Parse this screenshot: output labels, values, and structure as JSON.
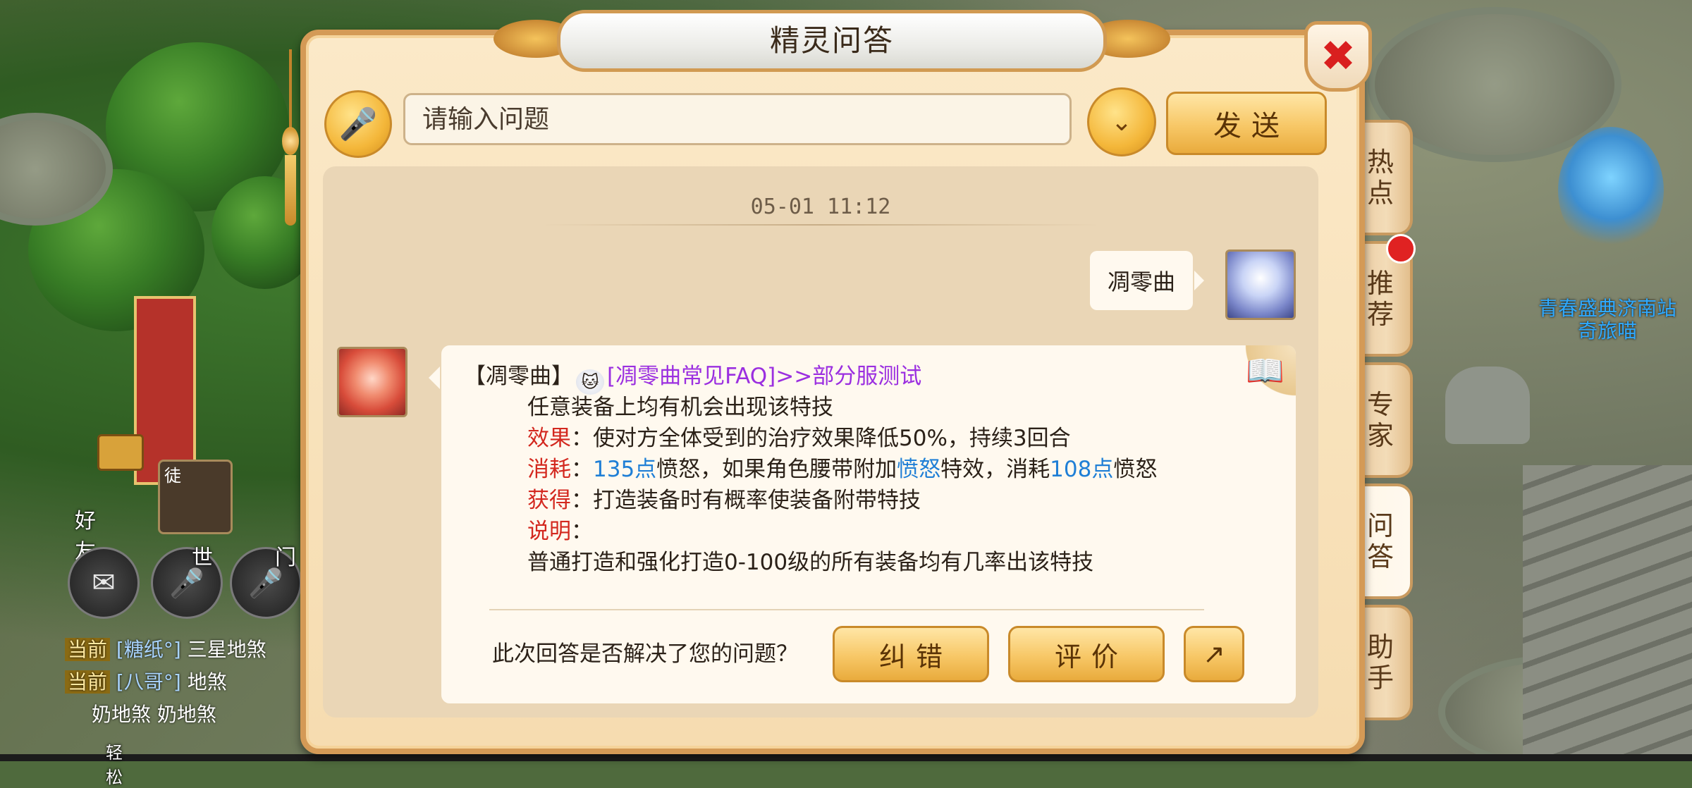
{
  "window": {
    "title": "精灵问答"
  },
  "search": {
    "placeholder": "请输入问题",
    "send_label": "发送"
  },
  "chat": {
    "timestamp": "05-01 11:12",
    "user_message": "凋零曲",
    "answer": {
      "prefix": "【凋零曲】",
      "faq_link": "[凋零曲常见FAQ]",
      "server_note": ">>部分服测试",
      "line1": "任意装备上均有机会出现该特技",
      "effect_label": "效果",
      "effect_text": "：使对方全体受到的治疗效果降低50%，持续3回合",
      "cost_label": "消耗",
      "cost_colon": "：",
      "cost_points1": "135点",
      "cost_text1": "愤怒，如果角色腰带附加",
      "cost_special": "愤怒",
      "cost_text2": "特效，消耗",
      "cost_points2": "108点",
      "cost_text3": "愤怒",
      "obtain_label": "获得",
      "obtain_text": "：打造装备时有概率使装备附带特技",
      "note_label": "说明",
      "note_colon": "：",
      "note_text": "普通打造和强化打造0-100级的所有装备均有几率出该特技"
    },
    "feedback": {
      "question": "此次回答是否解决了您的问题？",
      "fix_label": "纠错",
      "rate_label": "评价"
    }
  },
  "side_tabs": [
    {
      "label": "热点"
    },
    {
      "label": "推荐",
      "has_badge": true
    },
    {
      "label": "专家"
    },
    {
      "label": "问答",
      "active": true
    },
    {
      "label": "助手"
    }
  ],
  "hud": {
    "friends_label": "好友",
    "apprentice_label": "徒",
    "world_channel": "世",
    "sect_channel": "门",
    "chat_lines": [
      {
        "tag": "当前",
        "name": "[糖纸°]",
        "text": "三星地煞"
      },
      {
        "tag": "当前",
        "name": "[八哥°]",
        "text": "地煞"
      },
      {
        "tag": "",
        "name": "",
        "text": "奶地煞  奶地煞"
      }
    ],
    "bottom_label": "轻松"
  },
  "scene": {
    "npc_title": "青春盛典济南站",
    "npc_name": "奇旅喵"
  },
  "colors": {
    "accent_red": "#d3281f",
    "accent_blue": "#1f7fd6",
    "link_purple": "#9b2fe0",
    "panel_border": "#d49a56"
  },
  "icons": {
    "mic": "microphone-icon",
    "dropdown": "chevron-down-icon",
    "close": "close-icon",
    "share": "share-icon",
    "book": "book-icon",
    "chat_bubble": "chat-bubble-icon",
    "mail": "mail-icon"
  }
}
